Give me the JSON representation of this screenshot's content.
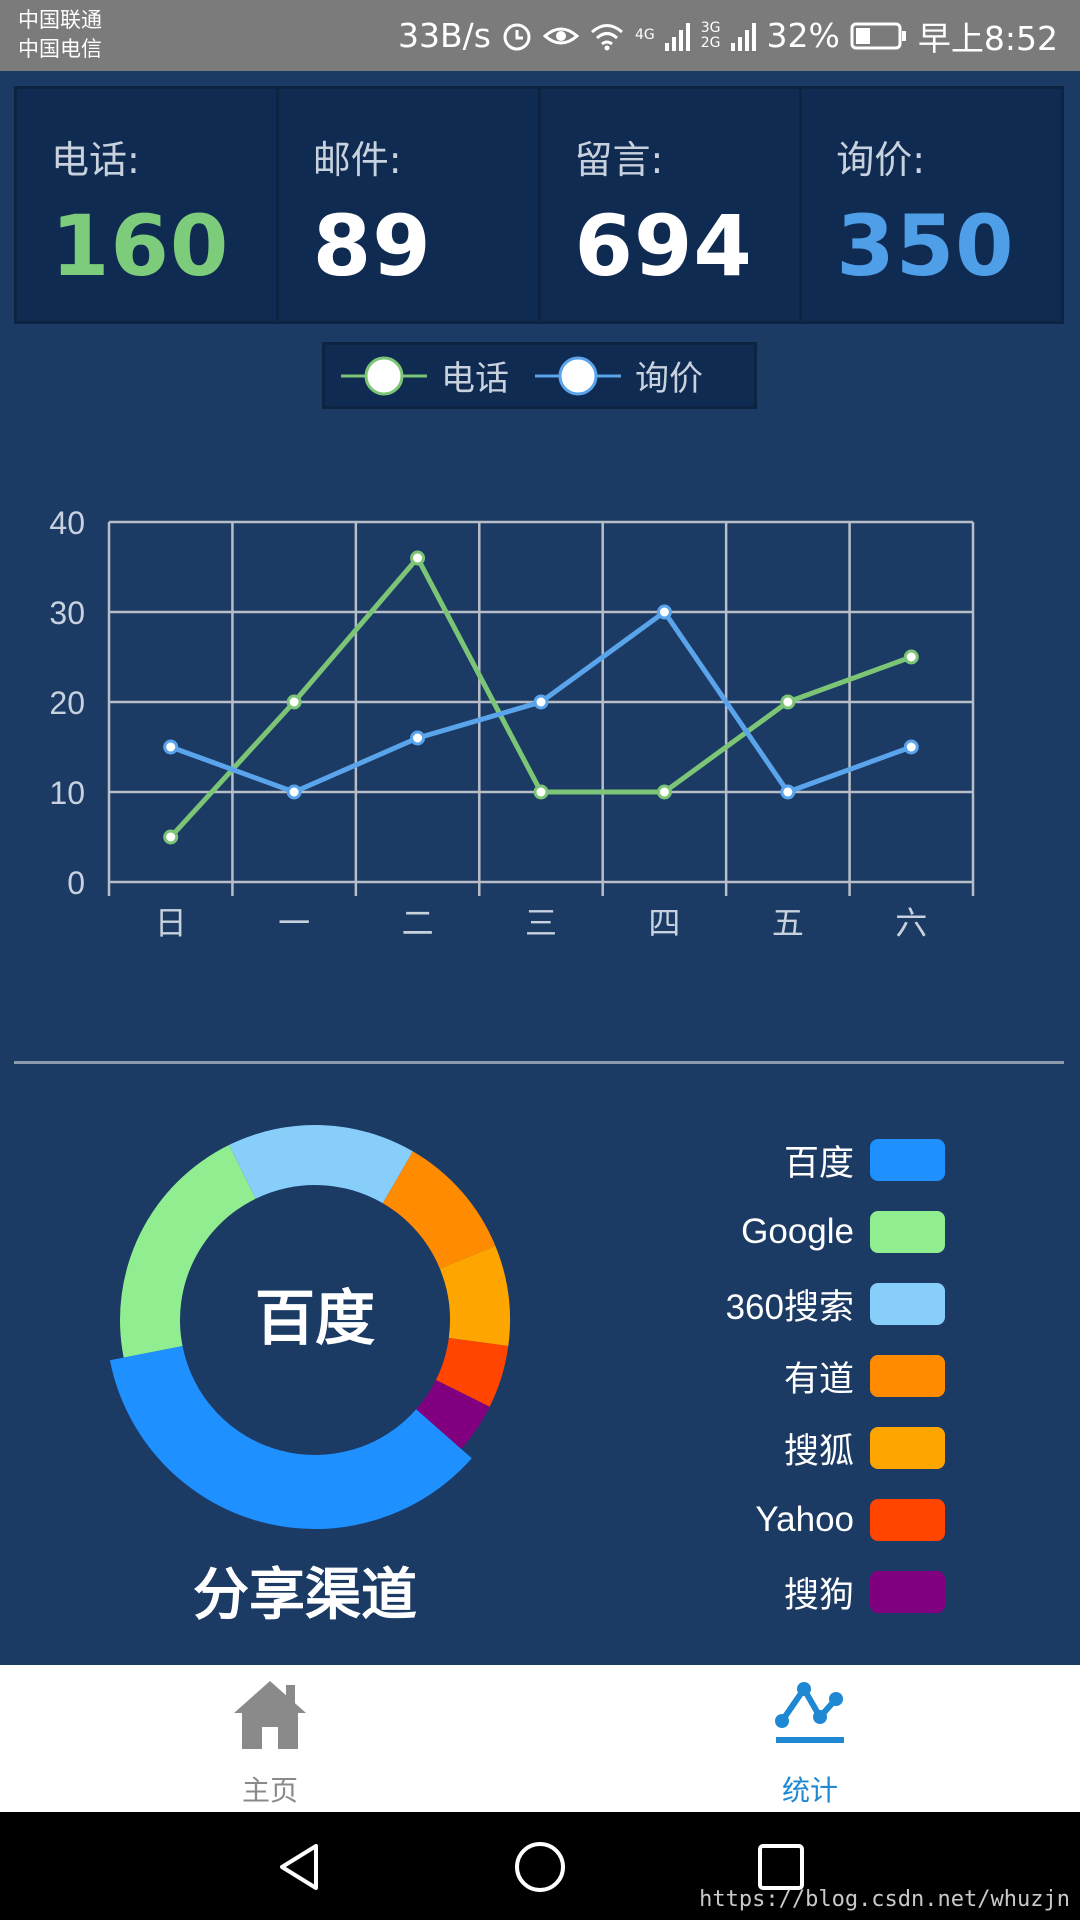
{
  "status_bar": {
    "carrier1": "中国联通",
    "carrier2": "中国电信",
    "speed": "33B/s",
    "net_4g": "4G",
    "net_3g": "3G",
    "net_2g": "2G",
    "battery": "32%",
    "time": "早上8:52"
  },
  "stats": [
    {
      "label": "电话:",
      "value": "160",
      "color": "#7ccc7c"
    },
    {
      "label": "邮件:",
      "value": "89",
      "color": "#ffffff"
    },
    {
      "label": "留言:",
      "value": "694",
      "color": "#ffffff"
    },
    {
      "label": "询价:",
      "value": "350",
      "color": "#4e9ee8"
    }
  ],
  "chart_data": [
    {
      "type": "line",
      "categories": [
        "日",
        "一",
        "二",
        "三",
        "四",
        "五",
        "六"
      ],
      "series": [
        {
          "name": "电话",
          "color": "#7cc576",
          "values": [
            5,
            20,
            36,
            10,
            10,
            20,
            25
          ]
        },
        {
          "name": "询价",
          "color": "#5aa4ec",
          "values": [
            15,
            10,
            16,
            20,
            30,
            10,
            15
          ]
        }
      ],
      "yticks": [
        0,
        10,
        20,
        30,
        40
      ],
      "ylim": [
        0,
        40
      ],
      "grid": true,
      "legend": "top-center"
    },
    {
      "type": "pie",
      "title": "分享渠道",
      "center_label": "百度",
      "slices": [
        {
          "name": "百度",
          "value": 34,
          "color": "#1e90ff"
        },
        {
          "name": "Google",
          "value": 20,
          "color": "#90ee90"
        },
        {
          "name": "360搜索",
          "value": 15,
          "color": "#87cefa"
        },
        {
          "name": "有道",
          "value": 10,
          "color": "#ff8c00"
        },
        {
          "name": "搜狐",
          "value": 8,
          "color": "#ffa500"
        },
        {
          "name": "Yahoo",
          "value": 5,
          "color": "#ff4500"
        },
        {
          "name": "搜狗",
          "value": 4,
          "color": "#800080"
        }
      ]
    }
  ],
  "bottom_nav": [
    {
      "label": "主页",
      "icon": "home-icon",
      "active": false
    },
    {
      "label": "统计",
      "icon": "stats-icon",
      "active": true
    }
  ],
  "colors": {
    "active": "#1e88d2",
    "inactive": "#8a8a8a"
  },
  "watermark": "https://blog.csdn.net/whuzjn"
}
